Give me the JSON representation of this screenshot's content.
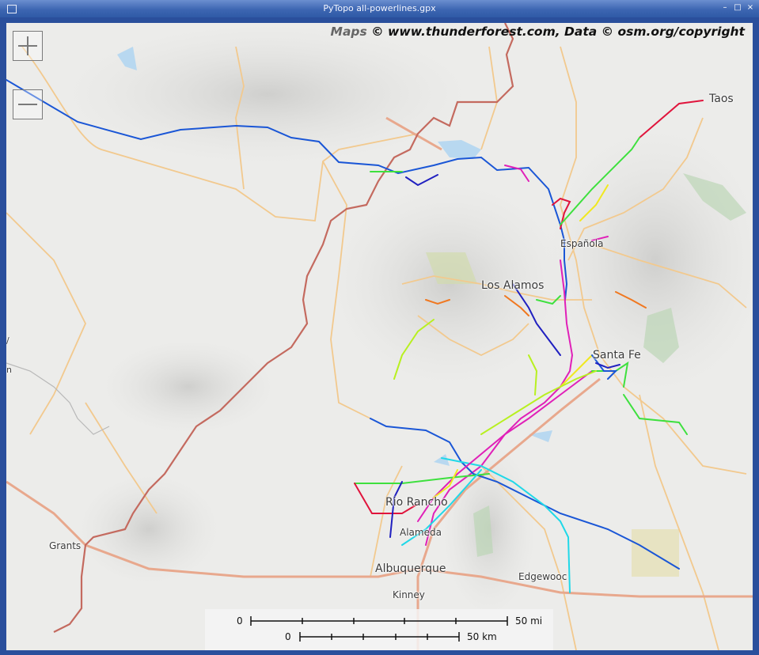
{
  "window": {
    "title": "PyTopo  all-powerlines.gpx",
    "buttons": [
      "–",
      "□",
      "×"
    ]
  },
  "map": {
    "attribution_maps": "Maps",
    "attribution_rest": "© www.thunderforest.com, Data © osm.org/copyright",
    "zoom_in_icon": "plus-icon",
    "zoom_out_icon": "minus-icon",
    "places": {
      "taos": "Taos",
      "espanola": "Española",
      "los_alamos": "Los Alamos",
      "santa_fe": "Santa Fe",
      "rio_rancho": "Rio Rancho",
      "alameda": "Alameda",
      "albuquerque": "Albuquerque",
      "edgewood": "Edgewooc",
      "kinney": "Kinney",
      "grants": "Grants"
    },
    "edge_fragments": [
      "/",
      "n"
    ]
  },
  "scale": {
    "mi_start": "0",
    "mi_end": "50 mi",
    "km_start": "0",
    "km_end": "50 km"
  },
  "colors": {
    "state_boundary": "#c46a5f",
    "road": "#f2c98e",
    "highway": "#e8a88d",
    "track_blue": "#1a56d6",
    "track_red": "#e0143c",
    "track_green": "#3ee03e",
    "track_lime": "#b8f020",
    "track_magenta": "#e020b8",
    "track_cyan": "#20d8e8",
    "track_yellow": "#f0e820",
    "track_orange": "#f07820",
    "track_navy": "#2020c0"
  }
}
